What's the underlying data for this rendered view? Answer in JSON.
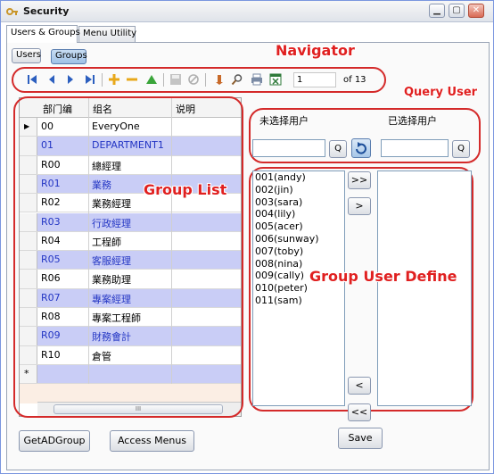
{
  "window": {
    "title": "Security"
  },
  "tabs": [
    {
      "label": "Users & Groups",
      "active": true
    },
    {
      "label": "Menu Utility",
      "active": false
    }
  ],
  "subtabs": {
    "users": "Users",
    "groups": "Groups"
  },
  "annotations": {
    "navigator": "Navigator",
    "query_user": "Query User",
    "group_list": "Group List",
    "group_user_define": "Group User Define"
  },
  "navigator": {
    "position": "1",
    "total": "of 13"
  },
  "grid": {
    "headers": [
      "部门编",
      "组名",
      "说明"
    ],
    "rows": [
      {
        "code": "00",
        "name": "EveryOne",
        "desc": ""
      },
      {
        "code": "01",
        "name": "DEPARTMENT1",
        "desc": ""
      },
      {
        "code": "R00",
        "name": "總經理",
        "desc": ""
      },
      {
        "code": "R01",
        "name": "業務",
        "desc": ""
      },
      {
        "code": "R02",
        "name": "業務經理",
        "desc": ""
      },
      {
        "code": "R03",
        "name": "行政經理",
        "desc": ""
      },
      {
        "code": "R04",
        "name": "工程師",
        "desc": ""
      },
      {
        "code": "R05",
        "name": "客服經理",
        "desc": ""
      },
      {
        "code": "R06",
        "name": "業務助理",
        "desc": ""
      },
      {
        "code": "R07",
        "name": "專案經理",
        "desc": ""
      },
      {
        "code": "R08",
        "name": "專案工程師",
        "desc": ""
      },
      {
        "code": "R09",
        "name": "財務會計",
        "desc": ""
      },
      {
        "code": "R10",
        "name": "倉管",
        "desc": ""
      }
    ],
    "new_row_marker": "*",
    "current_row_marker": "▶",
    "scroll_thumb": "III"
  },
  "query": {
    "unselected_label": "未选择用户",
    "selected_label": "已选择用户",
    "q_label": "Q"
  },
  "users_available": [
    "001(andy)",
    "002(jin)",
    "003(sara)",
    "004(lily)",
    "005(acer)",
    "006(sunway)",
    "007(toby)",
    "008(nina)",
    "009(cally)",
    "010(peter)",
    "011(sam)"
  ],
  "move_buttons": {
    "add_all": ">>",
    "add": ">",
    "remove": "<",
    "remove_all": "<<"
  },
  "buttons": {
    "get_ad_group": "GetADGroup",
    "access_menus": "Access Menus",
    "save": "Save"
  },
  "colors": {
    "alt_row": "#c9cdf6",
    "link_blue": "#2436c4",
    "annotation_red": "#e02020"
  }
}
